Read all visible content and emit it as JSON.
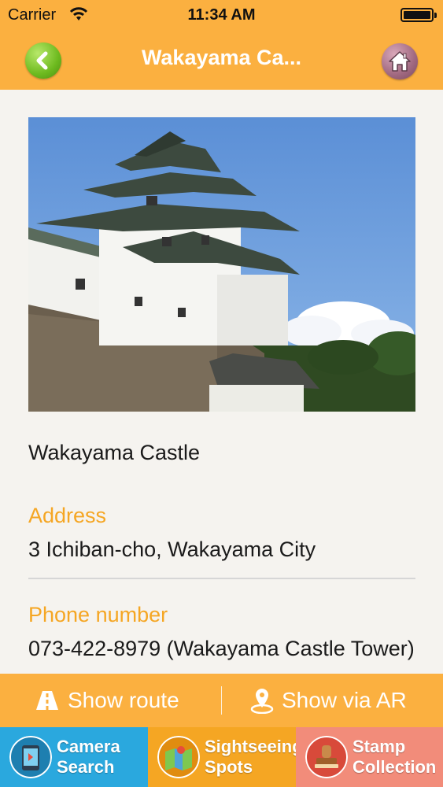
{
  "status_bar": {
    "carrier": "Carrier",
    "time": "11:34 AM"
  },
  "nav": {
    "title": "Wakayama Ca..."
  },
  "detail": {
    "name": "Wakayama Castle",
    "address_label": "Address",
    "address_value": "3 Ichiban-cho, Wakayama City",
    "phone_label": "Phone number",
    "phone_value": "073-422-8979 (Wakayama Castle Tower)"
  },
  "actions": {
    "route_label": "Show route",
    "ar_label": "Show via AR"
  },
  "tabs": [
    {
      "label": "Camera\nSearch",
      "color": "#2aa8de",
      "icon": "camera-icon"
    },
    {
      "label": "Sightseeing\nSpots",
      "color": "#f5a623",
      "icon": "map-icon"
    },
    {
      "label": "Stamp\nCollection",
      "color": "#f28c7a",
      "icon": "stamp-icon"
    }
  ],
  "colors": {
    "accent": "#fbb040",
    "label": "#f5a623",
    "back_button": "#6dba1f",
    "home_button": "#a06880"
  }
}
